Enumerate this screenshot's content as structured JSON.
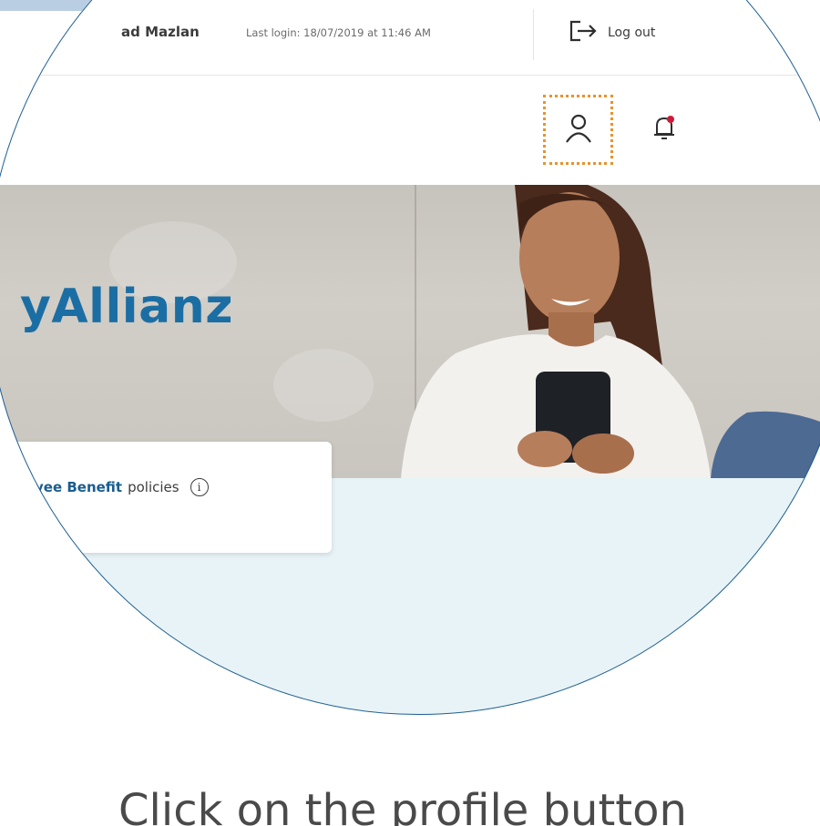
{
  "topbar": {
    "user_name": "ad Mazlan",
    "last_login": "Last login: 18/07/2019 at 11:46 AM",
    "logout_label": "Log out"
  },
  "navbar": {
    "profile_icon": "user-profile-icon",
    "notification_icon": "bell-icon",
    "notification_dot_color": "#d0183a"
  },
  "hero": {
    "brand_text": "yAllianz"
  },
  "policy_card": {
    "bold_text": "yee Benefit",
    "rest_text": "policies",
    "info_icon": "info-icon"
  },
  "caption": "Click on the profile button",
  "colors": {
    "brand": "#1b6ea4",
    "highlight": "#e8922e",
    "ring": "#1f5f93",
    "content_bg": "#e7f3f6"
  }
}
